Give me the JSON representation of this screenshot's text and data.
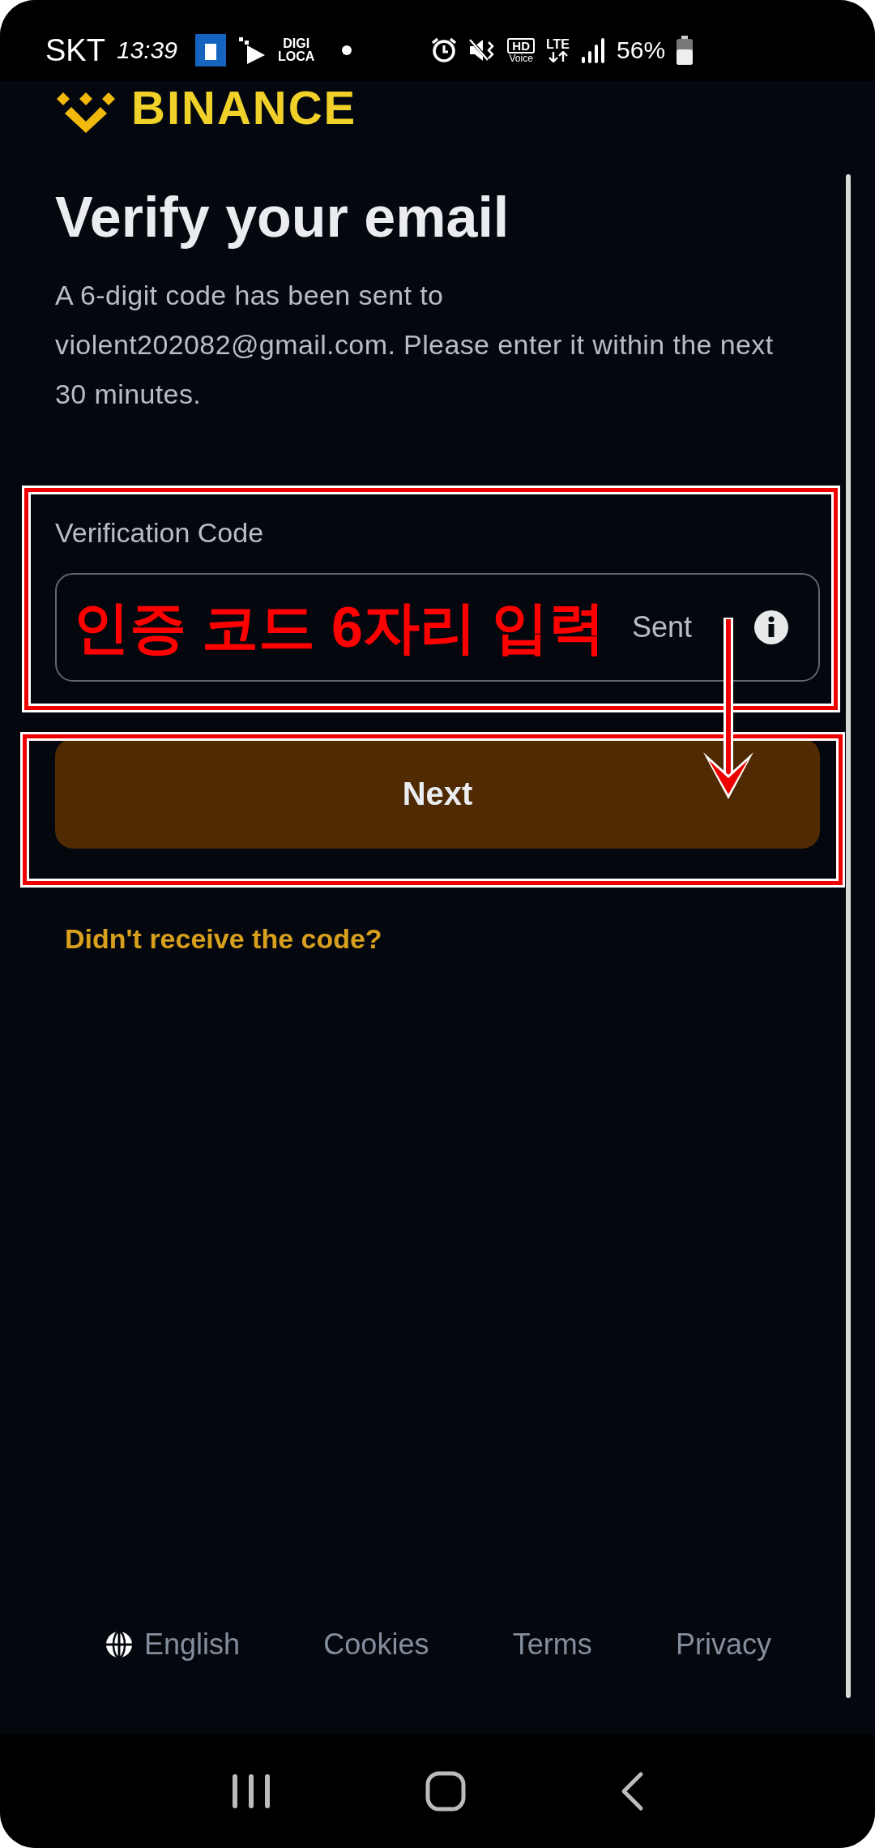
{
  "status_bar": {
    "carrier": "SKT",
    "time": "13:39",
    "app_badge": [
      "DIGI",
      "LOCA"
    ],
    "hd_badge": [
      "HD",
      "Voice"
    ],
    "network": "LTE",
    "battery": "56%"
  },
  "header": {
    "logo": "BINANCE"
  },
  "title": "Verify your email",
  "description": "A 6-digit code has been sent to violent202082@gmail.com. Please enter it within the next 30 minutes.",
  "code_field": {
    "label": "Verification Code",
    "suffix": "Sent"
  },
  "next_button": {
    "label": "Next",
    "disabled": true
  },
  "resend_link": "Didn't receive the code?",
  "footer": [
    {
      "kind": "language",
      "label": "English"
    },
    {
      "kind": "link",
      "label": "Cookies"
    },
    {
      "kind": "link",
      "label": "Terms"
    },
    {
      "kind": "link",
      "label": "Privacy"
    }
  ],
  "annotation": {
    "text": "인증 코드 6자리 입력"
  }
}
